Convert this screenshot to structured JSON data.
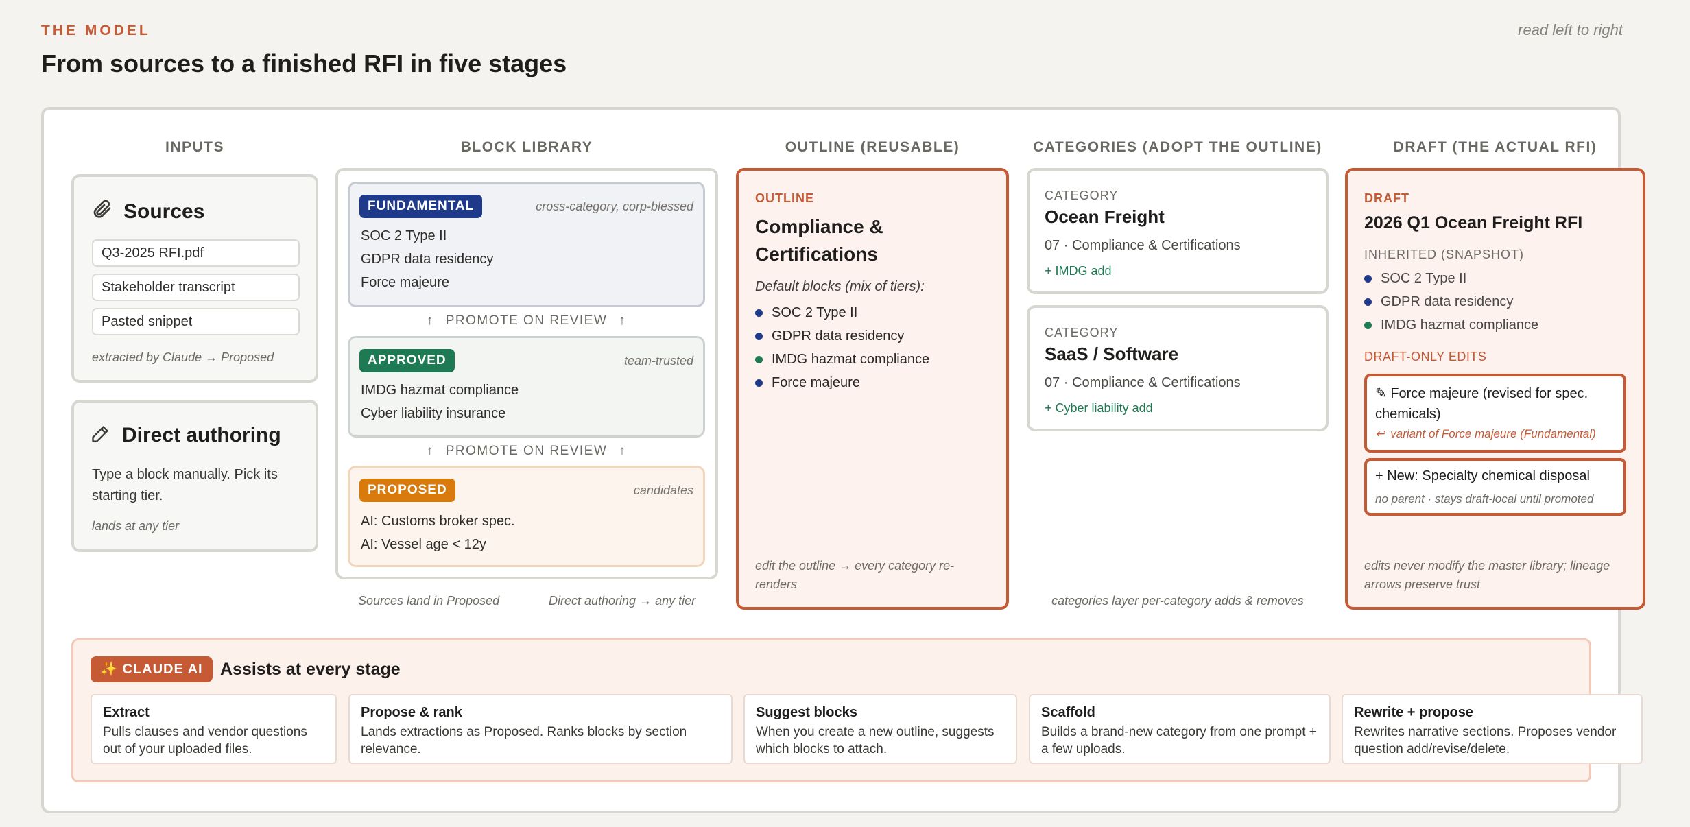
{
  "header": {
    "eyebrow": "THE MODEL",
    "title": "From sources to a finished RFI in five stages",
    "read_hint": "read left to right"
  },
  "columns": {
    "inputs": "INPUTS",
    "library": "BLOCK LIBRARY",
    "outline": "OUTLINE (REUSABLE)",
    "categories": "CATEGORIES (ADOPT THE OUTLINE)",
    "draft": "DRAFT (THE ACTUAL RFI)"
  },
  "inputs": {
    "sources": {
      "icon": "paperclip-icon",
      "title": "Sources",
      "files": [
        "Q3-2025 RFI.pdf",
        "Stakeholder transcript",
        "Pasted snippet"
      ],
      "note": "extracted by Claude → Proposed"
    },
    "authoring": {
      "icon": "pencil-icon",
      "title": "Direct authoring",
      "body": "Type a block manually. Pick its starting tier.",
      "note": "lands at any tier"
    }
  },
  "library": {
    "tiers": [
      {
        "badge": "FUNDAMENTAL",
        "note": "cross-category, corp-blessed",
        "items": [
          "SOC 2 Type II",
          "GDPR data residency",
          "Force majeure"
        ],
        "color": "#1f3a8a"
      },
      {
        "badge": "APPROVED",
        "note": "team-trusted",
        "items": [
          "IMDG hazmat compliance",
          "Cyber liability insurance"
        ],
        "color": "#1e7a52"
      },
      {
        "badge": "PROPOSED",
        "note": "candidates",
        "items": [
          "AI: Customs broker spec.",
          "AI: Vessel age < 12y"
        ],
        "color": "#d97a0c"
      }
    ],
    "promote_label": "PROMOTE ON REVIEW",
    "footer_left": "Sources land in Proposed",
    "footer_right": "Direct authoring → any tier"
  },
  "outline": {
    "kicker": "OUTLINE",
    "title_line1": "Compliance &",
    "title_line2": "Certifications",
    "subtitle": "Default blocks (mix of tiers):",
    "blocks": [
      {
        "label": "SOC 2 Type II",
        "tier": "fundamental"
      },
      {
        "label": "GDPR data residency",
        "tier": "fundamental"
      },
      {
        "label": "IMDG hazmat compliance",
        "tier": "approved"
      },
      {
        "label": "Force majeure",
        "tier": "fundamental"
      }
    ],
    "footer": "edit the outline → every category re-renders"
  },
  "categories": {
    "items": [
      {
        "kicker": "CATEGORY",
        "title": "Ocean Freight",
        "outline_ref": "07 · Compliance & Certifications",
        "add": "IMDG add"
      },
      {
        "kicker": "CATEGORY",
        "title": "SaaS / Software",
        "outline_ref": "07 · Compliance & Certifications",
        "add": "Cyber liability add"
      }
    ],
    "add_prefix": "+",
    "footer": "categories layer per-category adds & removes"
  },
  "draft": {
    "kicker": "DRAFT",
    "title": "2026 Q1 Ocean Freight RFI",
    "inherited_label": "INHERITED (SNAPSHOT)",
    "inherited": [
      {
        "label": "SOC 2 Type II",
        "tier": "fundamental"
      },
      {
        "label": "GDPR data residency",
        "tier": "fundamental"
      },
      {
        "label": "IMDG hazmat compliance",
        "tier": "approved"
      }
    ],
    "edits_label": "DRAFT-ONLY EDITS",
    "edit1_title": "✎ Force majeure (revised for spec. chemicals)",
    "edit1_lineage": "variant of Force majeure (Fundamental)",
    "edit2_title": "+ New: Specialty chemical disposal",
    "edit2_note": "no parent · stays draft-local until promoted",
    "footer": "edits never modify the master library; lineage arrows preserve trust"
  },
  "claude": {
    "badge": "✨ CLAUDE AI",
    "title": "Assists at every stage",
    "cards": [
      {
        "title": "Extract",
        "desc": "Pulls clauses and vendor questions out of your uploaded files."
      },
      {
        "title": "Propose & rank",
        "desc": "Lands extractions as Proposed. Ranks blocks by section relevance."
      },
      {
        "title": "Suggest blocks",
        "desc": "When you create a new outline, suggests which blocks to attach."
      },
      {
        "title": "Scaffold",
        "desc": "Builds a brand-new category from one prompt + a few uploads."
      },
      {
        "title": "Rewrite + propose",
        "desc": "Rewrites narrative sections. Proposes vendor question add/revise/delete."
      }
    ]
  },
  "colors": {
    "accent": "#c65a34",
    "fundamental": "#1f3a8a",
    "approved": "#1e7a52",
    "proposed": "#d97a0c"
  }
}
